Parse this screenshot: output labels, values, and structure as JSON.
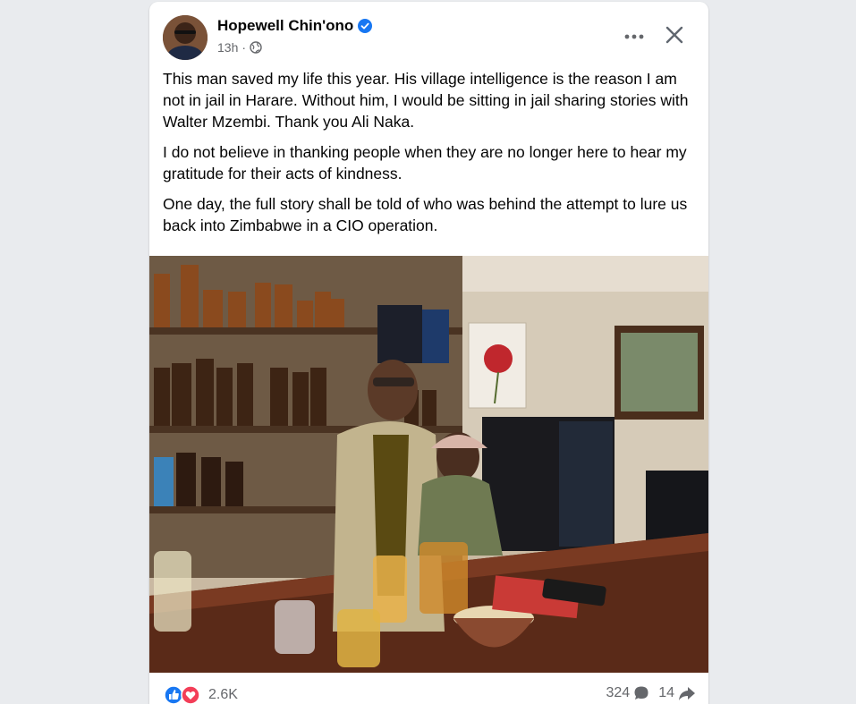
{
  "post": {
    "author": "Hopewell Chin'ono",
    "verified": true,
    "time": "13h",
    "separator": "·",
    "audience_icon": "globe-icon",
    "paragraphs": [
      "This man saved my life this year. His village intelligence is the reason I am not in jail in Harare. Without him, I would be sitting in jail sharing stories with Walter Mzembi. Thank you Ali Naka.",
      "I do not believe in thanking people when they are no longer here to hear my gratitude for their acts of kindness.",
      "One day, the full story shall be told of who was behind the attempt to lure us back into Zimbabwe in a CIO operation."
    ]
  },
  "actions": {
    "more_icon": "more-horizontal-icon",
    "close_icon": "close-icon"
  },
  "footer": {
    "reaction_count": "2.6K",
    "comment_count": "324",
    "share_count": "14",
    "reaction_icons": [
      "like-icon",
      "love-icon"
    ]
  },
  "colors": {
    "verified": "#1877f2",
    "like": "#1877f2",
    "love": "#f33e58",
    "secondary_text": "#65676b",
    "page_bg": "#e9ebee"
  }
}
